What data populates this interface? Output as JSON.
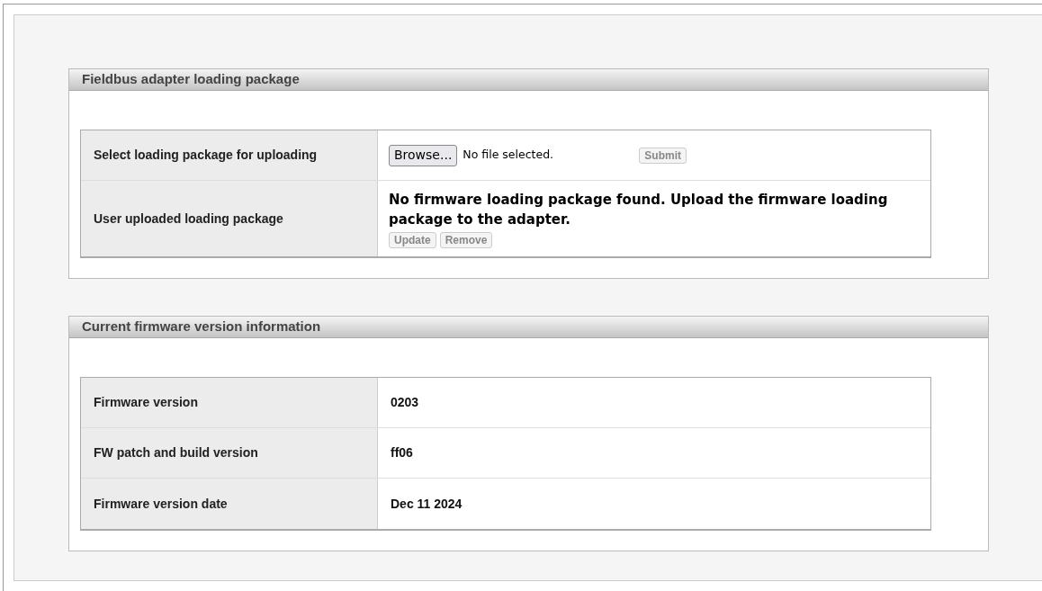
{
  "upload_section": {
    "title": "Fieldbus adapter loading package",
    "select_row": {
      "label": "Select loading package for uploading",
      "browse_button": "Browse...",
      "file_status": "No file selected.",
      "submit_button": {
        "label": "Submit",
        "disabled": true
      }
    },
    "uploaded_row": {
      "label": "User uploaded loading package",
      "message": "No firmware loading package found. Upload the firmware loading package to the adapter.",
      "buttons": [
        {
          "label": "Update",
          "disabled": true
        },
        {
          "label": "Remove",
          "disabled": true
        }
      ]
    }
  },
  "firmware_section": {
    "title": "Current firmware version information",
    "rows": [
      {
        "label": "Firmware version",
        "value": "0203"
      },
      {
        "label": "FW patch and build version",
        "value": "ff06"
      },
      {
        "label": "Firmware version date",
        "value": "Dec 11 2024"
      }
    ]
  }
}
